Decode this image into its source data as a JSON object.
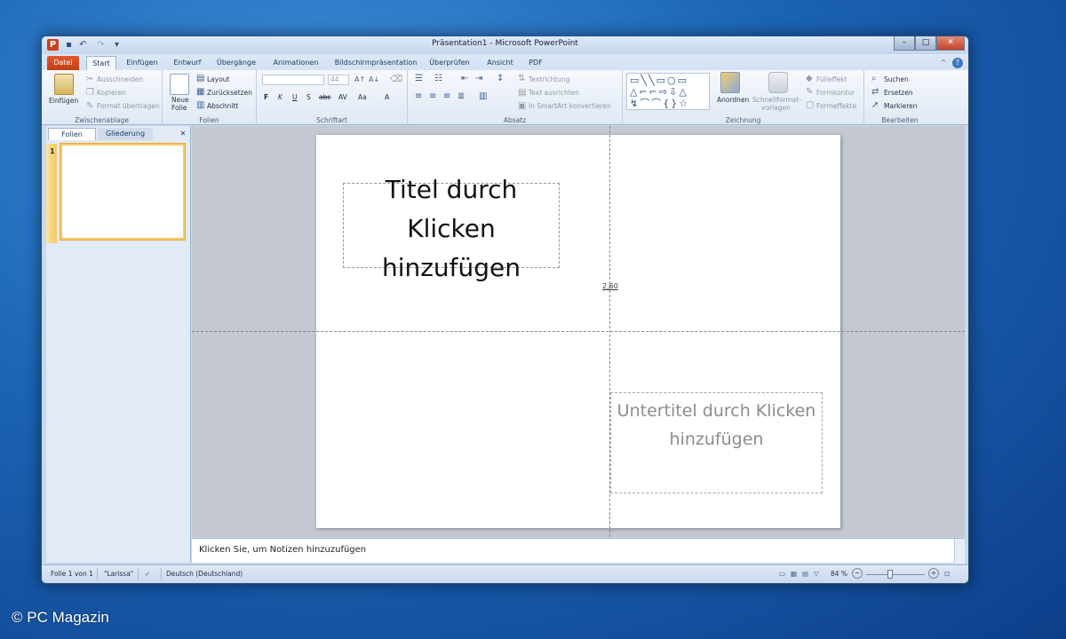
{
  "window": {
    "title": "Präsentation1 - Microsoft PowerPoint",
    "app_icon_letter": "P",
    "qat_icons": [
      "save-icon",
      "undo-icon",
      "redo-icon",
      "customize-qat-icon"
    ],
    "minimize_symbol": "–",
    "maximize_symbol": "□",
    "close_symbol": "✕"
  },
  "tabs": {
    "file": "Datei",
    "items": [
      "Start",
      "Einfügen",
      "Entwurf",
      "Übergänge",
      "Animationen",
      "Bildschirmpräsentation",
      "Überprüfen",
      "Ansicht",
      "PDF"
    ],
    "active": "Start",
    "help_symbol": "?",
    "collapse_symbol": "^"
  },
  "ribbon": {
    "clipboard": {
      "label": "Zwischenablage",
      "paste": "Einfügen",
      "cut": "Ausschneiden",
      "copy": "Kopieren",
      "format_painter": "Format übertragen"
    },
    "slides": {
      "label": "Folien",
      "new_slide_line1": "Neue",
      "new_slide_line2": "Folie",
      "layout": "Layout",
      "reset": "Zurücksetzen",
      "section": "Abschnitt"
    },
    "font": {
      "label": "Schriftart",
      "size": "44",
      "bold": "F",
      "italic": "K",
      "underline": "U",
      "shadow": "S",
      "strike": "abc",
      "spacing": "AV",
      "case": "Aa",
      "color": "A"
    },
    "paragraph": {
      "label": "Absatz",
      "text_direction": "Textrichtung",
      "align_text": "Text ausrichten",
      "smartart": "In SmartArt konvertieren"
    },
    "drawing": {
      "label": "Zeichnung",
      "arrange": "Anordnen",
      "quick_styles_line1": "Schnellformat-",
      "quick_styles_line2": "vorlagen",
      "fill": "Fülleffekt",
      "outline": "Formkontur",
      "effects": "Formeffekte"
    },
    "editing": {
      "label": "Bearbeiten",
      "find": "Suchen",
      "replace": "Ersetzen",
      "select": "Markieren"
    }
  },
  "left_pane": {
    "tab_slides": "Folien",
    "tab_outline": "Gliederung",
    "close_symbol": "✕",
    "slide_number": "1"
  },
  "slide": {
    "title_placeholder": "Titel durch Klicken hinzufügen",
    "subtitle_placeholder": "Untertitel durch Klicken hinzufügen",
    "guide_value": "2,60"
  },
  "notes": {
    "placeholder": "Klicken Sie, um Notizen hinzuzufügen"
  },
  "statusbar": {
    "slide_info": "Folie 1 von 1",
    "theme": "\"Larissa\"",
    "language": "Deutsch (Deutschland)",
    "zoom": "84 %",
    "zoom_out": "−",
    "zoom_in": "+"
  },
  "watermark": "© PC Magazin",
  "colors": {
    "file_tab": "#d24a1f",
    "accent": "#2a4d82"
  }
}
